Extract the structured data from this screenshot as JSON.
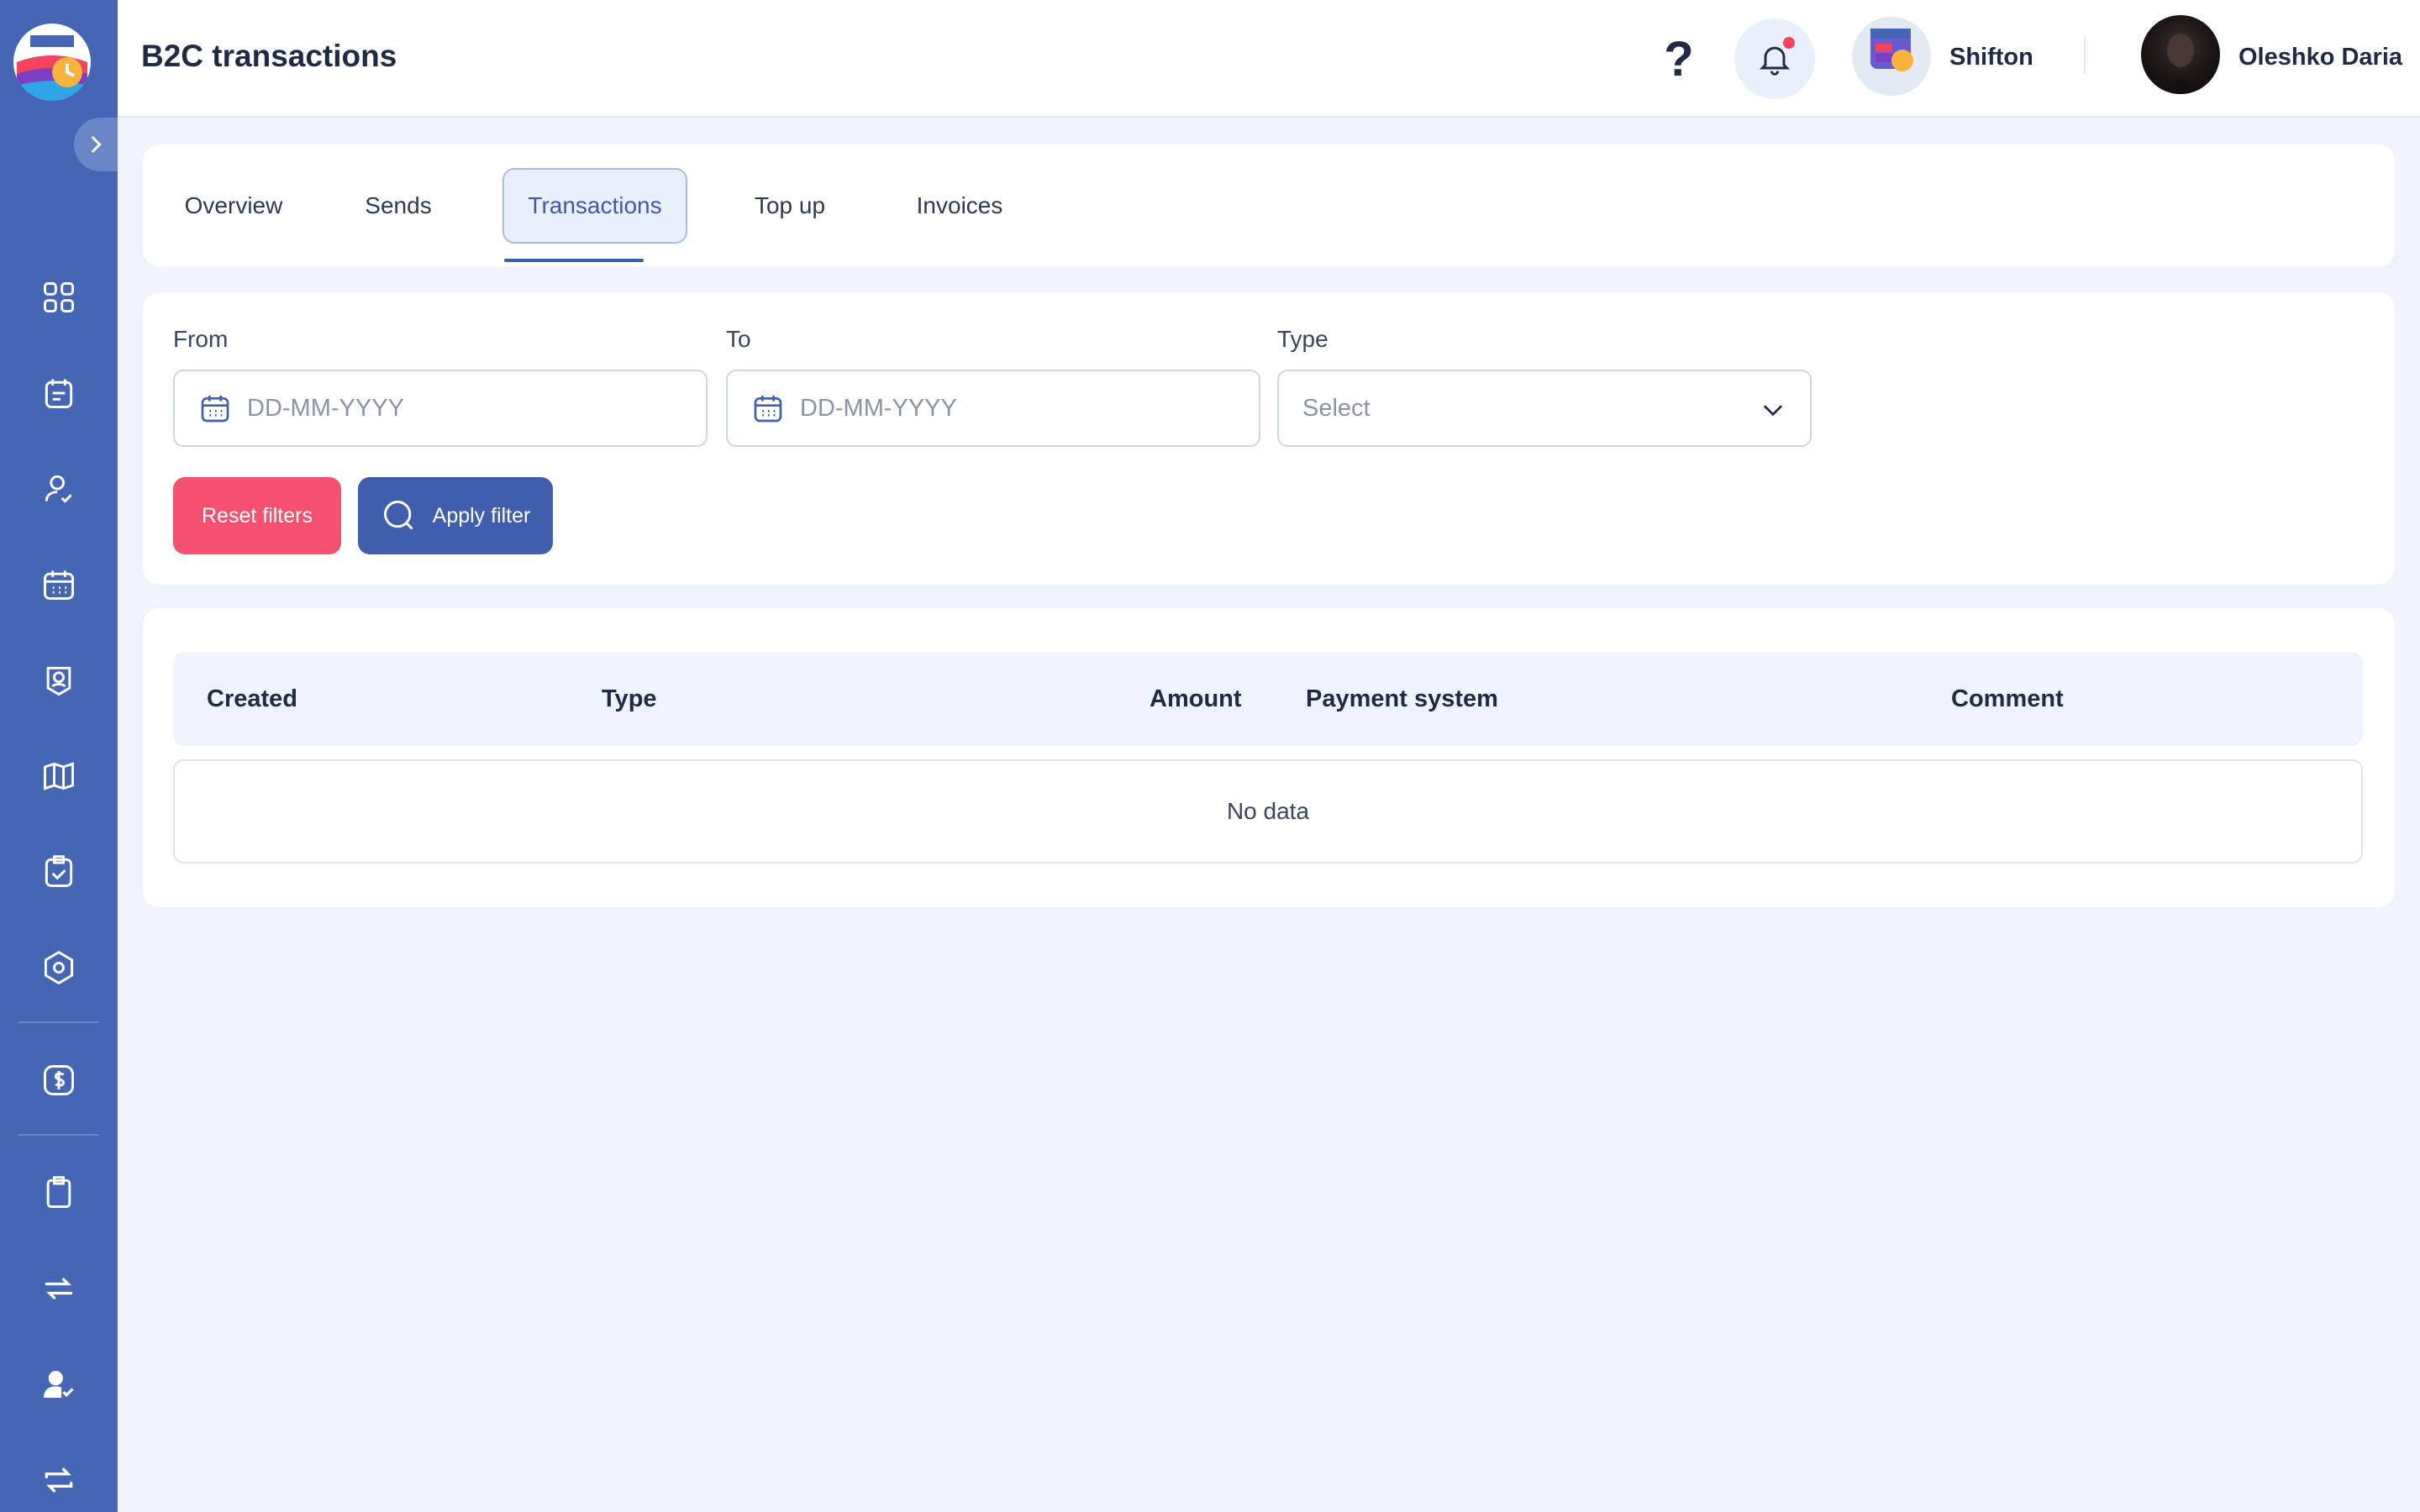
{
  "header": {
    "title": "B2C transactions",
    "help_label": "?",
    "company_name": "Shifton",
    "user_name": "Oleshko Daria"
  },
  "tabs": [
    {
      "label": "Overview"
    },
    {
      "label": "Sends"
    },
    {
      "label": "Transactions",
      "active": true
    },
    {
      "label": "Top up"
    },
    {
      "label": "Invoices"
    }
  ],
  "filters": {
    "from_label": "From",
    "from_placeholder": "DD-MM-YYYY",
    "to_label": "To",
    "to_placeholder": "DD-MM-YYYY",
    "type_label": "Type",
    "type_value": "Select",
    "reset_label": "Reset filters",
    "apply_label": "Apply filter"
  },
  "table": {
    "columns": [
      "Created",
      "Type",
      "Amount",
      "Payment system",
      "Comment"
    ],
    "empty_text": "No data"
  },
  "sidebar": {
    "icons": [
      "dashboard-icon",
      "schedule-icon",
      "employee-icon",
      "calendar-icon",
      "badge-icon",
      "map-icon",
      "task-icon",
      "settings-icon",
      "billing-icon",
      "clipboard-icon",
      "swap-icon",
      "user-check-icon",
      "exchange-icon"
    ]
  },
  "colors": {
    "sidebar": "#4466b5",
    "accent": "#3f5eae",
    "danger": "#f5506f",
    "background": "#eef3fc"
  }
}
